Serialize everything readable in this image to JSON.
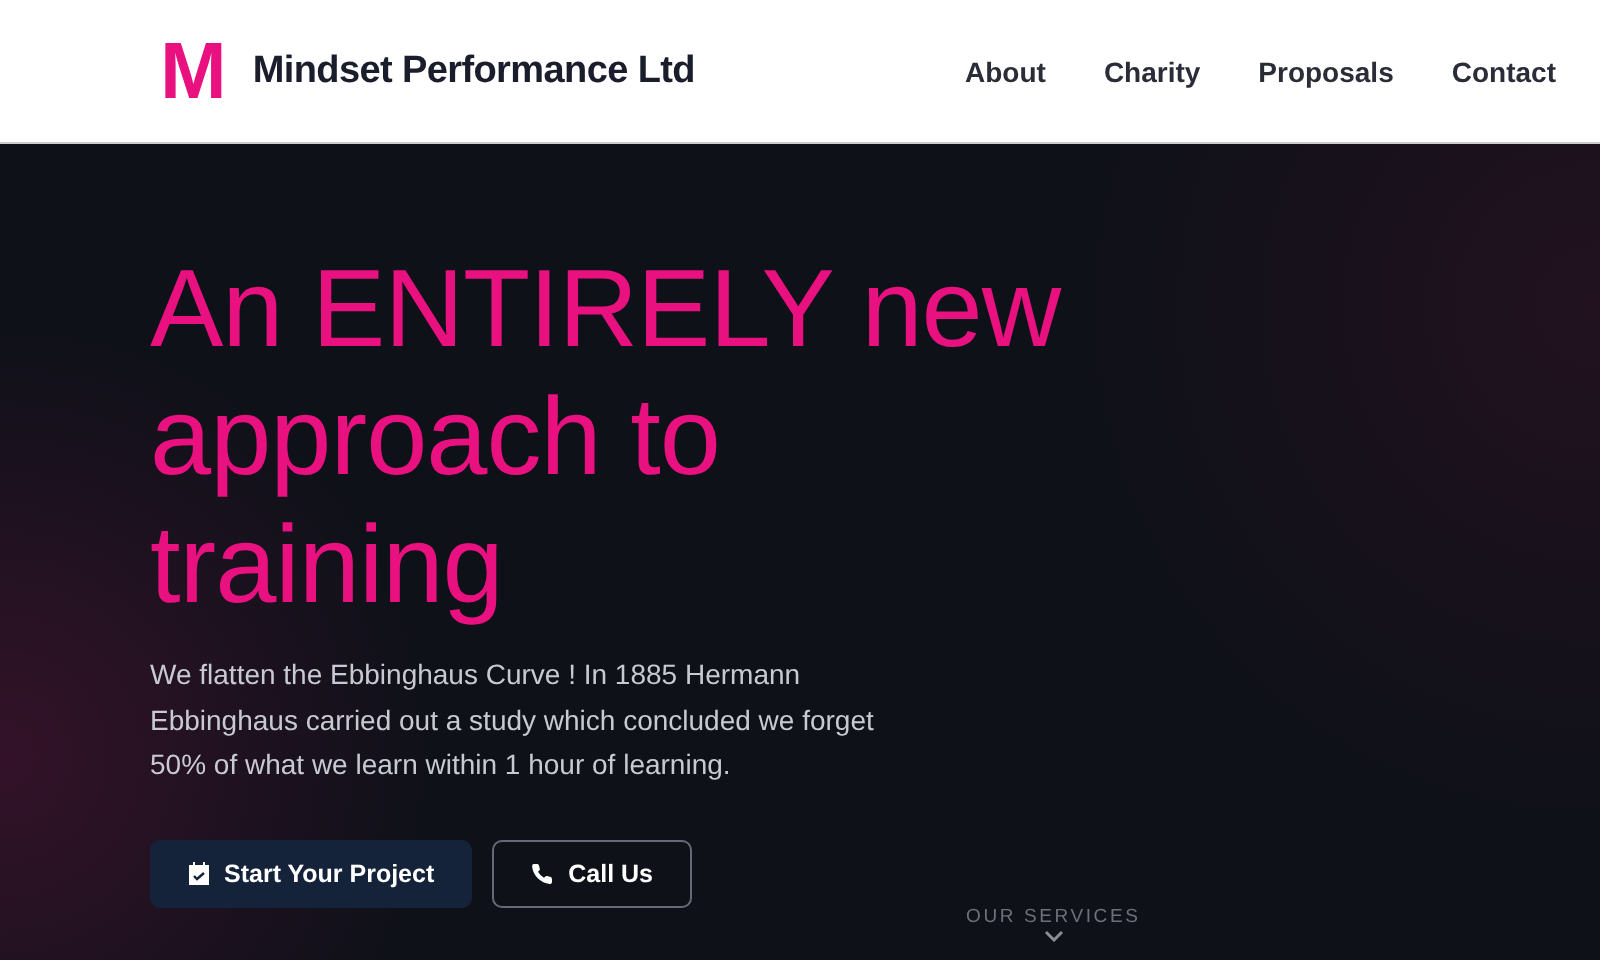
{
  "brand": {
    "logo": "M",
    "name": "Mindset Performance Ltd"
  },
  "nav": [
    {
      "label": "About"
    },
    {
      "label": "Charity"
    },
    {
      "label": "Proposals"
    },
    {
      "label": "Contact"
    }
  ],
  "hero": {
    "title_lines": [
      "An ENTIRELY new",
      "approach to",
      "training"
    ],
    "description": "We flatten the Ebbinghaus Curve ! In 1885 Hermann Ebbinghaus carried out a study which concluded we forget 50% of what we learn within 1 hour of learning.",
    "buttons": [
      {
        "label": "Start Your Project",
        "kind": "primary"
      },
      {
        "label": "Call Us",
        "kind": "outline"
      }
    ]
  },
  "scroll_hint": {
    "label": "OUR SERVICES"
  }
}
